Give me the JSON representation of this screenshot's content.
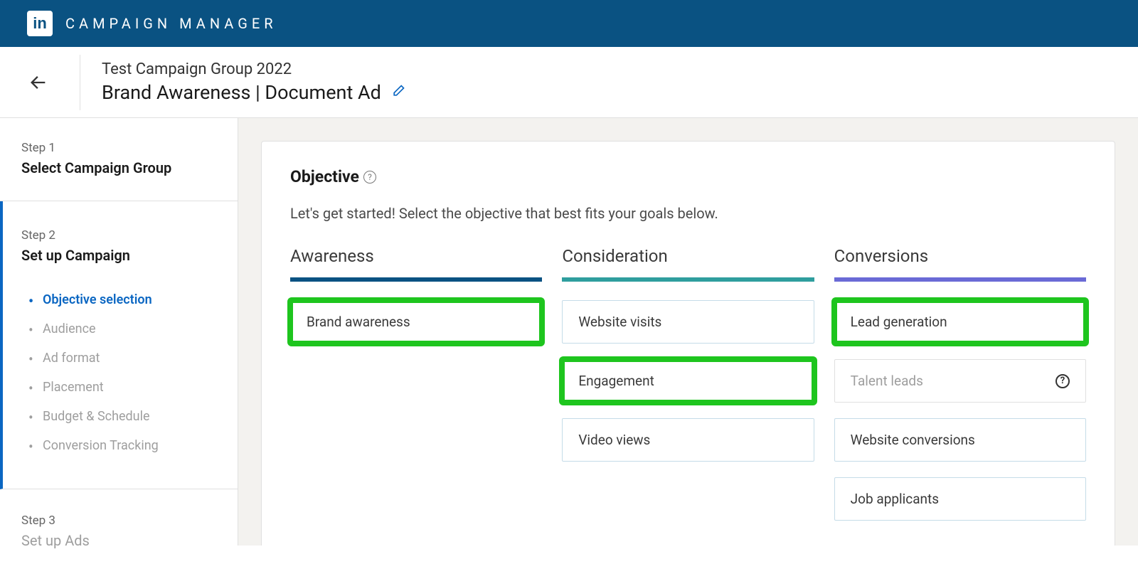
{
  "app": {
    "logo_text": "in",
    "title": "CAMPAIGN MANAGER"
  },
  "header": {
    "campaign_group": "Test Campaign Group 2022",
    "campaign_name": "Brand Awareness | Document Ad"
  },
  "sidebar": {
    "step1": {
      "number": "Step 1",
      "title": "Select Campaign Group"
    },
    "step2": {
      "number": "Step 2",
      "title": "Set up Campaign",
      "items": [
        {
          "label": "Objective selection",
          "active": true
        },
        {
          "label": "Audience",
          "active": false
        },
        {
          "label": "Ad format",
          "active": false
        },
        {
          "label": "Placement",
          "active": false
        },
        {
          "label": "Budget & Schedule",
          "active": false
        },
        {
          "label": "Conversion Tracking",
          "active": false
        }
      ]
    },
    "step3": {
      "number": "Step 3",
      "title": "Set up Ads"
    }
  },
  "panel": {
    "heading": "Objective",
    "subtext": "Let's get started! Select the objective that best fits your goals below.",
    "columns": {
      "awareness": {
        "title": "Awareness",
        "options": [
          {
            "label": "Brand awareness",
            "highlighted": true
          }
        ]
      },
      "consideration": {
        "title": "Consideration",
        "options": [
          {
            "label": "Website visits",
            "highlighted": false
          },
          {
            "label": "Engagement",
            "highlighted": true
          },
          {
            "label": "Video views",
            "highlighted": false
          }
        ]
      },
      "conversions": {
        "title": "Conversions",
        "options": [
          {
            "label": "Lead generation",
            "highlighted": true
          },
          {
            "label": "Talent leads",
            "highlighted": false,
            "disabled": true,
            "help": true
          },
          {
            "label": "Website conversions",
            "highlighted": false
          },
          {
            "label": "Job applicants",
            "highlighted": false
          }
        ]
      }
    }
  }
}
